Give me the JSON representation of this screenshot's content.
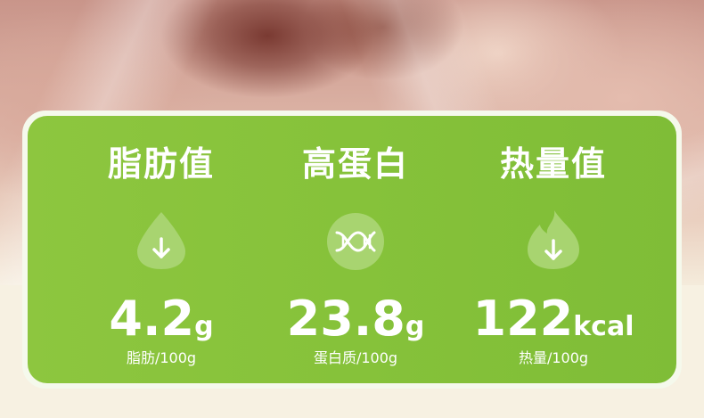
{
  "colors": {
    "card_green": "#86c23a",
    "icon_bg": "#a8d470",
    "text": "#ffffff",
    "cream": "#f7f1e2"
  },
  "items": [
    {
      "title": "脂肪值",
      "icon": "fat-drop-down-icon",
      "value": "4.2",
      "unit": "g",
      "note": "脂肪/100g"
    },
    {
      "title": "高蛋白",
      "icon": "dna-protein-icon",
      "value": "23.8",
      "unit": "g",
      "note": "蛋白质/100g"
    },
    {
      "title": "热量值",
      "icon": "flame-down-icon",
      "value": "122",
      "unit": "kcal",
      "note": "热量/100g"
    }
  ]
}
